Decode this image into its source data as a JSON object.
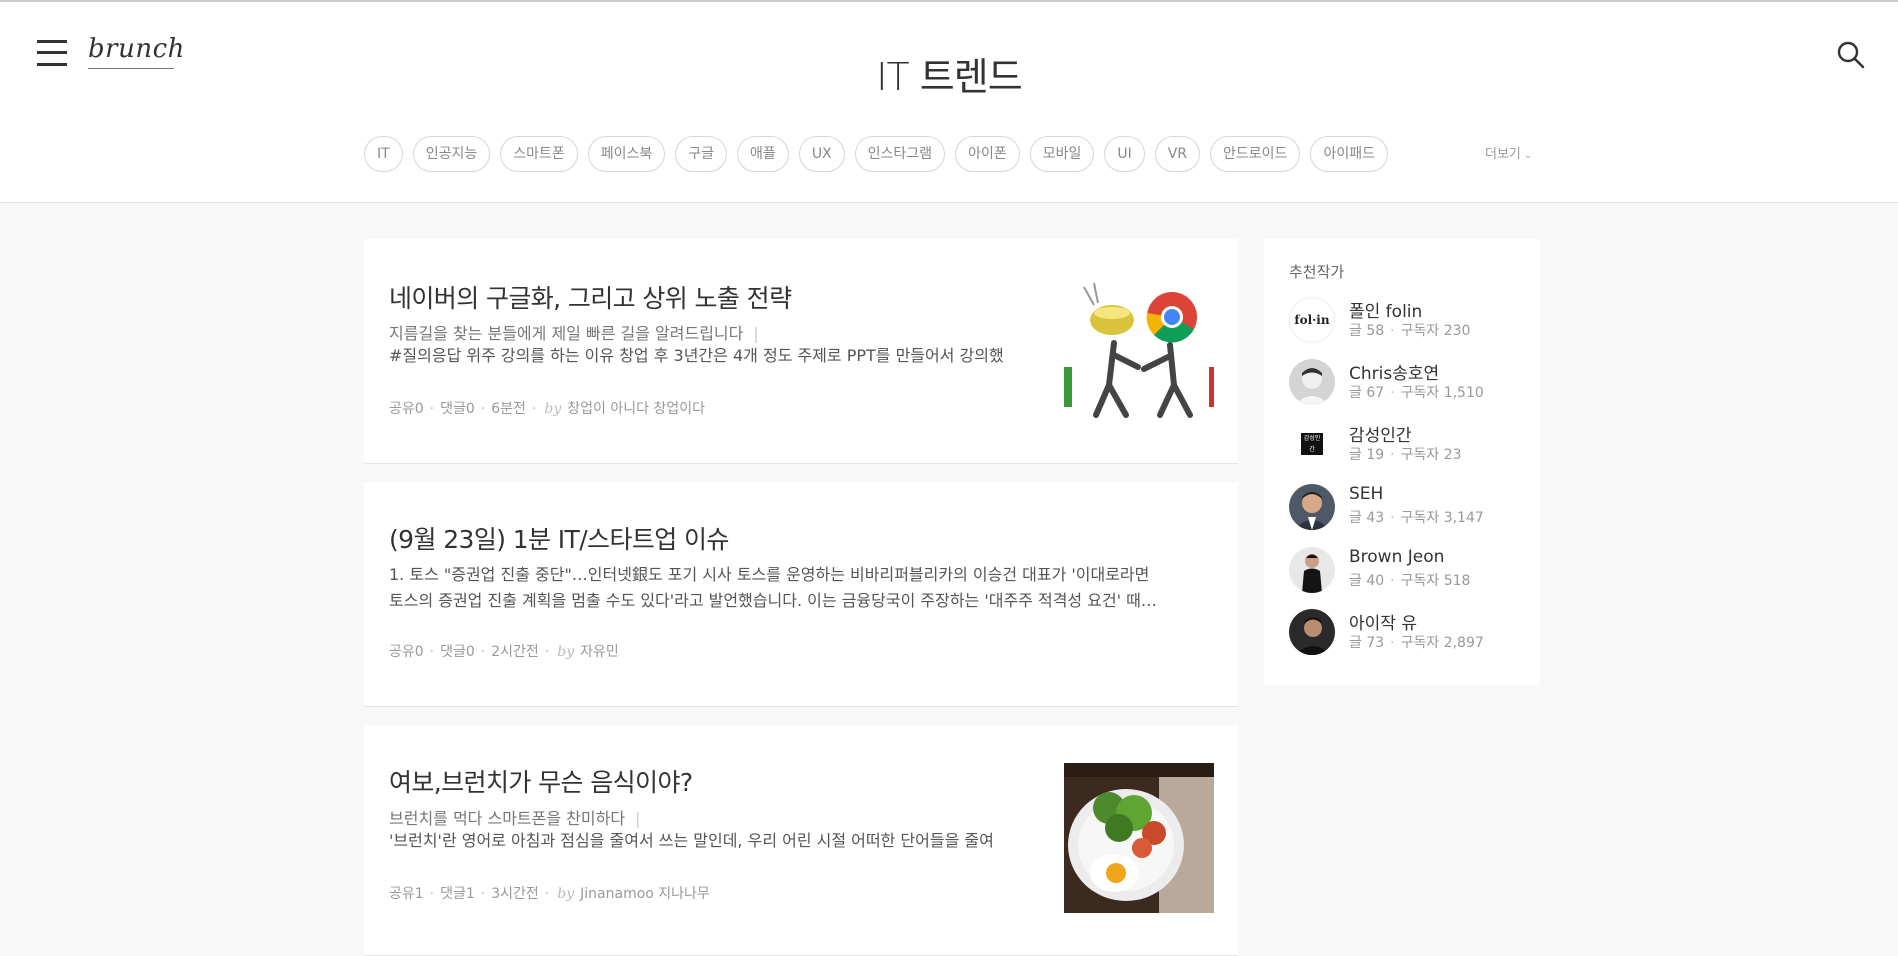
{
  "header": {
    "logo": "brunch",
    "title": "IT 트렌드"
  },
  "keywords": [
    "IT",
    "인공지능",
    "스마트폰",
    "페이스북",
    "구글",
    "애플",
    "UX",
    "인스타그램",
    "아이폰",
    "모바일",
    "UI",
    "VR",
    "안드로이드",
    "아이패드"
  ],
  "more_label": "더보기",
  "articles": [
    {
      "title": "네이버의 구글화, 그리고 상위 노출 전략",
      "subtitle": "지름길을 찾는 분들에게 제일 빠른 길을 알려드립니다",
      "desc1": "#질의응답 위주 강의를 하는 이유 창업 후 3년간은 4개 정도 주제로 PPT를 만들어서 강의했",
      "desc2": "",
      "shares": "공유0",
      "comments": "댓글0",
      "time": "6분전",
      "by": "by",
      "author": "창업이 아니다 창업이다"
    },
    {
      "title": "(9월 23일) 1분 IT/스타트업 이슈",
      "subtitle": "",
      "desc1": "1. 토스 \"증권업 진출 중단\"…인터넷銀도 포기 시사 토스를 운영하는 비바리퍼블리카의 이승건 대표가 '이대로라면",
      "desc2": "토스의 증권업 진출 계획을 멈출 수도 있다'라고 발언했습니다. 이는 금융당국이 주장하는 '대주주 적격성 요건' 때…",
      "shares": "공유0",
      "comments": "댓글0",
      "time": "2시간전",
      "by": "by",
      "author": "자유민"
    },
    {
      "title": "여보,브런치가 무슨 음식이야?",
      "subtitle": "브런치를 먹다 스마트폰을 찬미하다",
      "desc1": "'브런치'란 영어로 아침과 점심을 줄여서 쓰는 말인데, 우리 어린 시절 어떠한 단어들을 줄여",
      "desc2": "",
      "shares": "공유1",
      "comments": "댓글1",
      "time": "3시간전",
      "by": "by",
      "author": "Jinanamoo 지나나무"
    }
  ],
  "sidebar": {
    "title": "추천작가",
    "writers": [
      {
        "name": "폴인 folin",
        "posts": "글 58",
        "subscribers": "구독자 230",
        "avatar_text": "fol·in"
      },
      {
        "name": "Chris송호연",
        "posts": "글 67",
        "subscribers": "구독자 1,510"
      },
      {
        "name": "감성인간",
        "posts": "글 19",
        "subscribers": "구독자 23",
        "avatar_text": "감성인간"
      },
      {
        "name": "SEH",
        "posts": "글 43",
        "subscribers": "구독자 3,147"
      },
      {
        "name": "Brown Jeon",
        "posts": "글 40",
        "subscribers": "구독자 518"
      },
      {
        "name": "아이작 유",
        "posts": "글 73",
        "subscribers": "구독자 2,897"
      }
    ]
  }
}
